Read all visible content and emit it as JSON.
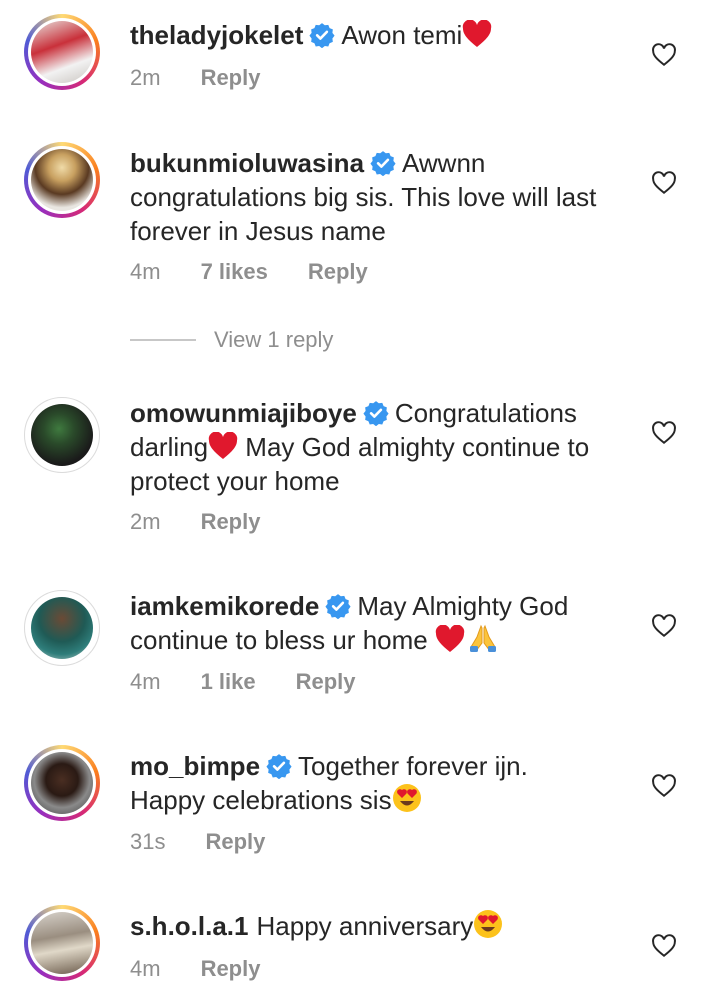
{
  "comments": [
    {
      "username": "theladyjokelet",
      "text": "Awon temi",
      "emoji": "heart",
      "time": "2m",
      "likes": "",
      "reply": "Reply"
    },
    {
      "username": "bukunmioluwasina",
      "text": "Awwnn congratulations big sis. This love will last forever in Jesus name",
      "emoji": "",
      "time": "4m",
      "likes": "7 likes",
      "reply": "Reply"
    },
    {
      "username": "omowunmiajiboye",
      "text_a": "Congratulations darling",
      "text_b": " May God almighty continue to protect your home",
      "emoji": "heart",
      "time": "2m",
      "likes": "",
      "reply": "Reply"
    },
    {
      "username": "iamkemikorede",
      "text": "May Almighty God continue to bless ur home ",
      "emoji": "heart,pray",
      "time": "4m",
      "likes": "1 like",
      "reply": "Reply"
    },
    {
      "username": "mo_bimpe",
      "text": "Together forever ijn. Happy celebrations sis",
      "emoji": "heart-eyes",
      "time": "31s",
      "likes": "",
      "reply": "Reply"
    },
    {
      "username": "s.h.o.l.a.1",
      "text": "Happy anniversary",
      "emoji": "heart-eyes",
      "time": "4m",
      "likes": "",
      "reply": "Reply"
    }
  ],
  "view_replies": "View 1 reply",
  "colors": {
    "text": "#262626",
    "meta": "#8e8e8e",
    "verified": "#3897f0",
    "heart": "#ed1c24"
  },
  "icons": [
    "verified-badge-icon",
    "like-heart-icon",
    "red-heart-emoji",
    "folded-hands-emoji",
    "heart-eyes-emoji"
  ]
}
